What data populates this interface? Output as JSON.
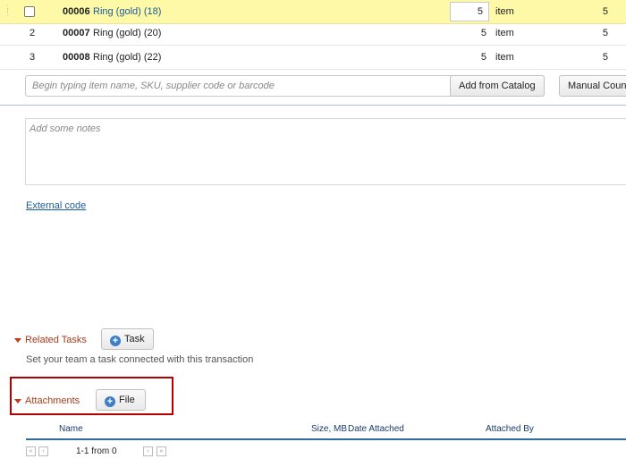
{
  "rows": [
    {
      "index": "",
      "sku": "00006",
      "name": "Ring (gold) (18)",
      "qty": "5",
      "unit": "item",
      "amount": "5",
      "selected": true
    },
    {
      "index": "2",
      "sku": "00007",
      "name": "Ring (gold) (20)",
      "qty": "5",
      "unit": "item",
      "amount": "5",
      "selected": false
    },
    {
      "index": "3",
      "sku": "00008",
      "name": "Ring (gold) (22)",
      "qty": "5",
      "unit": "item",
      "amount": "5",
      "selected": false
    }
  ],
  "add_item": {
    "placeholder": "Begin typing item name, SKU, supplier code or barcode",
    "add_from_catalog": "Add from Catalog",
    "manual_count": "Manual Count"
  },
  "notes": {
    "placeholder": "Add some notes"
  },
  "external_code_link": "External code",
  "related_tasks": {
    "title": "Related Tasks",
    "button": "Task",
    "hint": "Set your team a task connected with this transaction"
  },
  "attachments": {
    "title": "Attachments",
    "button": "File",
    "columns": {
      "name": "Name",
      "size": "Size, MB",
      "date": "Date Attached",
      "by": "Attached By"
    },
    "pagination": "1-1 from 0"
  },
  "colors": {
    "selected_row": "#fdf9a6",
    "section_title": "#a83a1a",
    "link": "#1a5b9a",
    "highlight_box": "#b30000"
  }
}
